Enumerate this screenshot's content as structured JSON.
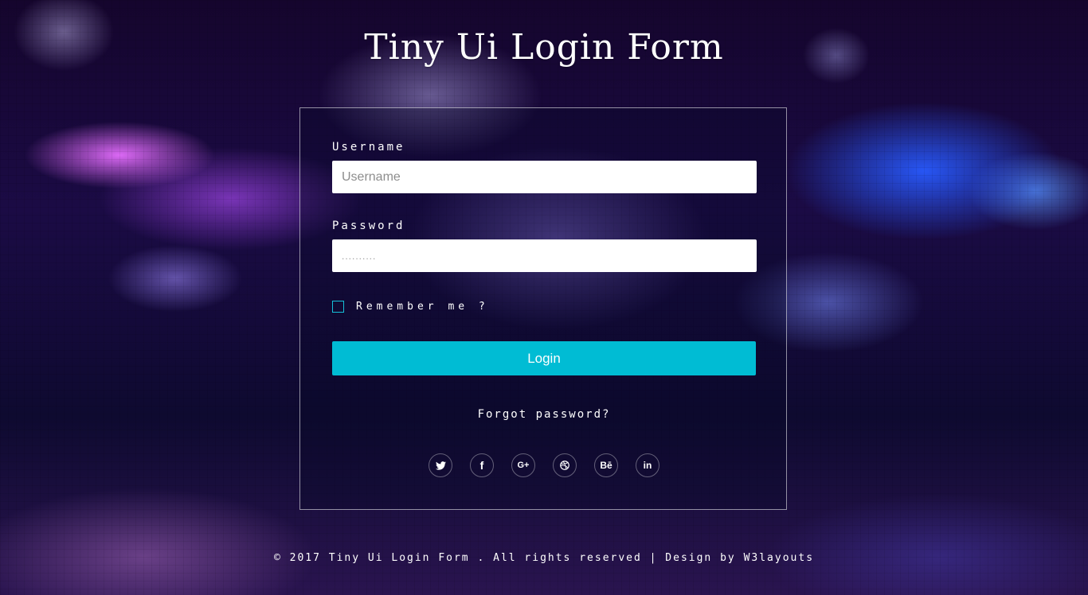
{
  "page": {
    "title": "Tiny Ui Login Form"
  },
  "form": {
    "username": {
      "label": "Username",
      "placeholder": "Username",
      "value": ""
    },
    "password": {
      "label": "Password",
      "placeholder": "..........",
      "value": ""
    },
    "remember": {
      "label": "Remember me ?",
      "checked": false
    },
    "login_label": "Login",
    "forgot_label": "Forgot password?"
  },
  "social": [
    {
      "icon": "twitter-icon",
      "glyph": ""
    },
    {
      "icon": "facebook-icon",
      "glyph": "f"
    },
    {
      "icon": "google-plus-icon",
      "glyph": "G+"
    },
    {
      "icon": "dribbble-icon",
      "glyph": ""
    },
    {
      "icon": "behance-icon",
      "glyph": "Bē"
    },
    {
      "icon": "linkedin-icon",
      "glyph": "in"
    }
  ],
  "footer": {
    "text": "© 2017 Tiny Ui Login Form . All rights reserved | Design by ",
    "link": "W3layouts"
  },
  "colors": {
    "accent": "#00bcd4",
    "checkbox_border": "#15c0d9",
    "text": "#ffffff"
  }
}
